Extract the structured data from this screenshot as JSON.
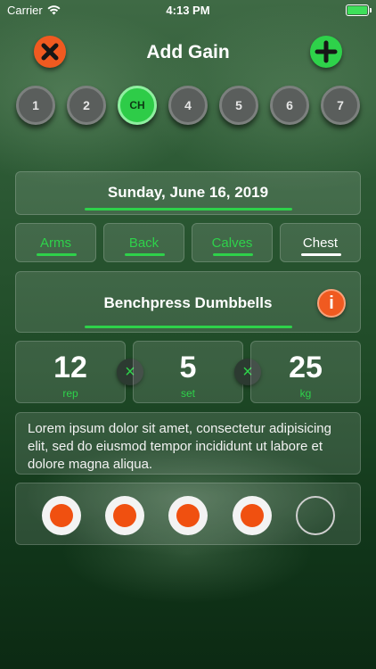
{
  "status_bar": {
    "carrier": "Carrier",
    "time": "4:13 PM"
  },
  "nav": {
    "title": "Add Gain",
    "close_icon": "close-icon",
    "add_icon": "plus-icon"
  },
  "days": [
    "1",
    "2",
    "CH",
    "4",
    "5",
    "6",
    "7"
  ],
  "active_day_index": 2,
  "date": "Sunday, June 16, 2019",
  "muscle_tabs": [
    "Arms",
    "Back",
    "Calves",
    "Chest"
  ],
  "selected_tab_index": 3,
  "exercise": {
    "name": "Benchpress Dumbbells",
    "info_label": "i"
  },
  "entry": {
    "reps": {
      "value": "12",
      "unit": "rep"
    },
    "sets": {
      "value": "5",
      "unit": "set"
    },
    "weight": {
      "value": "25",
      "unit": "kg"
    },
    "times_symbol": "×"
  },
  "note": "Lorem ipsum dolor sit amet, consectetur adipisicing elit, sed do eiusmod tempor incididunt ut labore et dolore magna aliqua.",
  "set_tracker": {
    "completed": 4,
    "total": 5
  },
  "colors": {
    "accent_green": "#2ed24a",
    "accent_orange": "#f05a20"
  }
}
